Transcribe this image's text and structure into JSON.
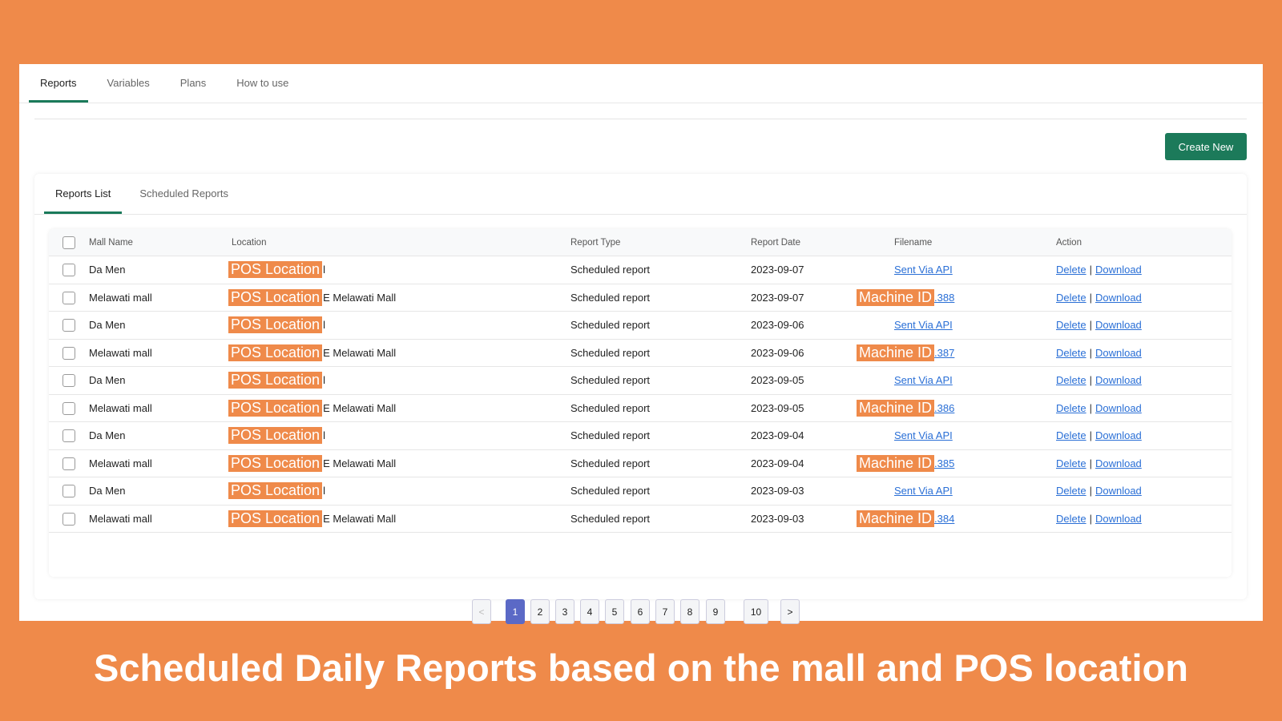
{
  "nav": {
    "tabs": [
      "Reports",
      "Variables",
      "Plans",
      "How to use"
    ],
    "active": 0
  },
  "create_button": "Create New",
  "subtabs": {
    "items": [
      "Reports List",
      "Scheduled Reports"
    ],
    "active": 0
  },
  "table": {
    "headers": [
      "Mall Name",
      "Location",
      "Report Type",
      "Report Date",
      "Filename",
      "Action"
    ],
    "rows": [
      {
        "mall": "Da Men",
        "loc_tag": "POS Location",
        "loc_rest": "l",
        "type": "Scheduled report",
        "date": "2023-09-07",
        "file_tag": "",
        "file_link": "Sent Via API"
      },
      {
        "mall": "Melawati mall",
        "loc_tag": "POS Location",
        "loc_rest": "E Melawati Mall",
        "type": "Scheduled report",
        "date": "2023-09-07",
        "file_tag": "Machine ID",
        "file_link": ".388"
      },
      {
        "mall": "Da Men",
        "loc_tag": "POS Location",
        "loc_rest": "l",
        "type": "Scheduled report",
        "date": "2023-09-06",
        "file_tag": "",
        "file_link": "Sent Via API"
      },
      {
        "mall": "Melawati mall",
        "loc_tag": "POS Location",
        "loc_rest": "E Melawati Mall",
        "type": "Scheduled report",
        "date": "2023-09-06",
        "file_tag": "Machine ID",
        "file_link": ".387"
      },
      {
        "mall": "Da Men",
        "loc_tag": "POS Location",
        "loc_rest": "l",
        "type": "Scheduled report",
        "date": "2023-09-05",
        "file_tag": "",
        "file_link": "Sent Via API"
      },
      {
        "mall": "Melawati mall",
        "loc_tag": "POS Location",
        "loc_rest": "E Melawati Mall",
        "type": "Scheduled report",
        "date": "2023-09-05",
        "file_tag": "Machine ID",
        "file_link": ".386"
      },
      {
        "mall": "Da Men",
        "loc_tag": "POS Location",
        "loc_rest": "l",
        "type": "Scheduled report",
        "date": "2023-09-04",
        "file_tag": "",
        "file_link": "Sent Via API"
      },
      {
        "mall": "Melawati mall",
        "loc_tag": "POS Location",
        "loc_rest": "E Melawati Mall",
        "type": "Scheduled report",
        "date": "2023-09-04",
        "file_tag": "Machine ID",
        "file_link": ".385"
      },
      {
        "mall": "Da Men",
        "loc_tag": "POS Location",
        "loc_rest": "l",
        "type": "Scheduled report",
        "date": "2023-09-03",
        "file_tag": "",
        "file_link": "Sent Via API"
      },
      {
        "mall": "Melawati mall",
        "loc_tag": "POS Location",
        "loc_rest": "E Melawati Mall",
        "type": "Scheduled report",
        "date": "2023-09-03",
        "file_tag": "Machine ID",
        "file_link": ".384"
      }
    ],
    "actions": {
      "delete": "Delete",
      "separator": "|",
      "download": "Download"
    }
  },
  "pagination": {
    "prev": "<",
    "next": ">",
    "pages": [
      "1",
      "2",
      "3",
      "4",
      "5",
      "6",
      "7",
      "8",
      "9",
      "10"
    ],
    "current": "1"
  },
  "caption": "Scheduled Daily Reports based on the mall and POS location",
  "colors": {
    "background": "#EF8A4A",
    "primary": "#1C7A5A",
    "link": "#2a6fd6",
    "active_page": "#5B69C6"
  }
}
